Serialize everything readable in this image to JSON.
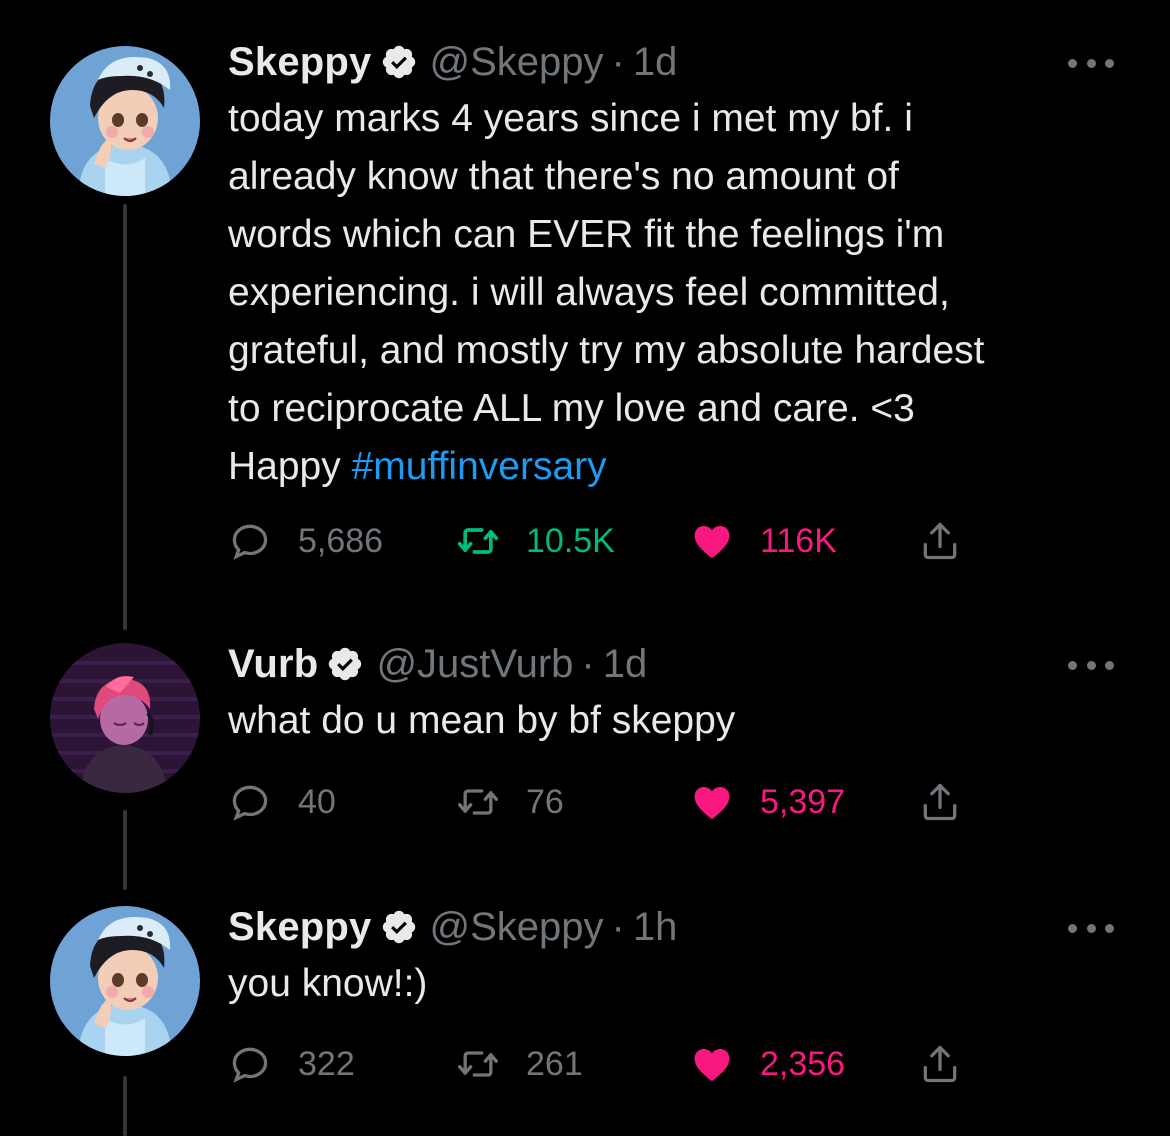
{
  "colors": {
    "background": "#000000",
    "text": "#e7e9ea",
    "muted": "#71767b",
    "hashtag": "#1d9bf0",
    "retweet_active": "#00ba7c",
    "like_active": "#f91880",
    "verified": "#e7e9ea"
  },
  "tweets": [
    {
      "name": "Skeppy",
      "handle": "@Skeppy",
      "dot": "·",
      "time": "1d",
      "text": "today marks 4 years since i met my bf. i\nalready know that there's no amount of\nwords which can EVER fit the feelings i'm\nexperiencing. i will always feel committed,\ngrateful, and mostly try my absolute hardest\nto reciprocate ALL my love and care. <3\nHappy ",
      "hashtag": "#muffinversary",
      "replies": "5,686",
      "retweets": "10.5K",
      "likes": "116K",
      "retweeted": true,
      "liked": true,
      "avatar_icon": "skeppy-avatar-icon"
    },
    {
      "name": "Vurb",
      "handle": "@JustVurb",
      "dot": "·",
      "time": "1d",
      "text": "what do u mean by bf skeppy",
      "hashtag": "",
      "replies": "40",
      "retweets": "76",
      "likes": "5,397",
      "retweeted": false,
      "liked": true,
      "avatar_icon": "vurb-avatar-icon"
    },
    {
      "name": "Skeppy",
      "handle": "@Skeppy",
      "dot": "·",
      "time": "1h",
      "text": "you know!:)",
      "hashtag": "",
      "replies": "322",
      "retweets": "261",
      "likes": "2,356",
      "retweeted": false,
      "liked": true,
      "avatar_icon": "skeppy-avatar-icon"
    }
  ]
}
